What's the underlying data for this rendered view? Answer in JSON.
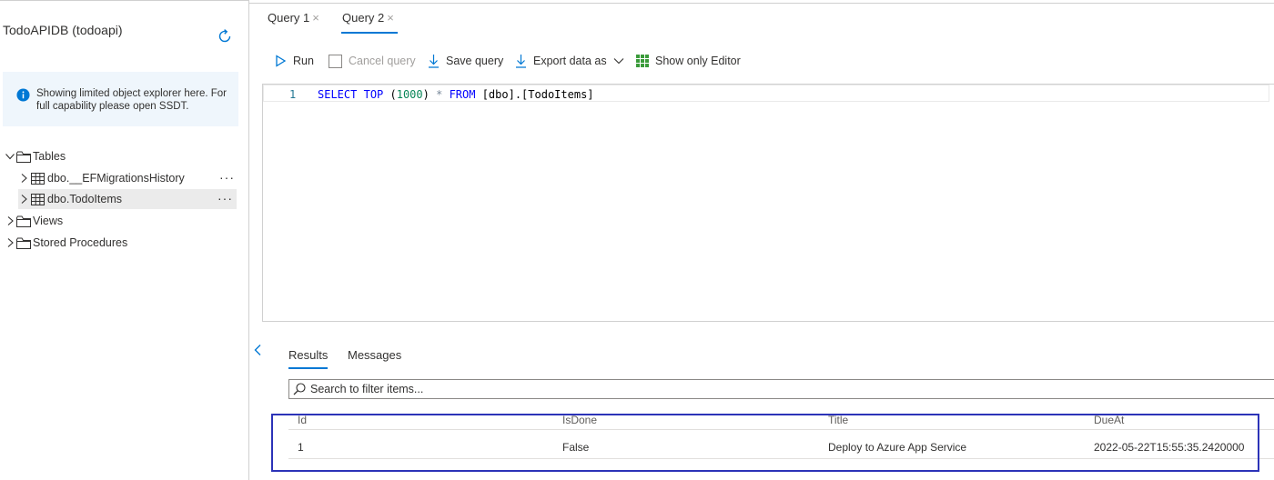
{
  "explorer": {
    "db_title": "TodoAPIDB (todoapi)",
    "info_text": "Showing limited object explorer here. For full capability please open SSDT.",
    "tree": {
      "tables_label": "Tables",
      "tables": [
        {
          "label": "dbo.__EFMigrationsHistory",
          "more": "···"
        },
        {
          "label": "dbo.TodoItems",
          "more": "···"
        }
      ],
      "views_label": "Views",
      "procedures_label": "Stored Procedures"
    }
  },
  "tabs": [
    {
      "label": "Query 1",
      "close": "×"
    },
    {
      "label": "Query 2",
      "close": "×"
    }
  ],
  "toolbar": {
    "run": "Run",
    "cancel": "Cancel query",
    "save": "Save query",
    "export": "Export data as",
    "show_editor": "Show only Editor"
  },
  "editor": {
    "line_number": "1",
    "tokens": {
      "select": "SELECT",
      "top": "TOP",
      "open_paren": " (",
      "limit": "1000",
      "close_paren": ") ",
      "star": "*",
      "from": "FROM",
      "target": " [dbo].[TodoItems]"
    }
  },
  "results": {
    "tabs": [
      "Results",
      "Messages"
    ],
    "filter_placeholder": "Search to filter items...",
    "columns": [
      "Id",
      "IsDone",
      "Title",
      "DueAt"
    ],
    "rows": [
      [
        "1",
        "False",
        "Deploy to Azure App Service",
        "2022-05-22T15:55:35.2420000"
      ]
    ]
  },
  "colors": {
    "accent": "#0078d4",
    "highlight_box": "#2c33b8",
    "info_background": "#eff6fc",
    "sql_keyword": "#0000ff",
    "sql_number": "#098658"
  },
  "icons": {
    "refresh": "refresh-icon",
    "info": "info-icon",
    "folder": "folder-icon",
    "table": "table-icon",
    "run": "play-icon",
    "cancel": "checkbox-icon",
    "save": "download-icon",
    "export": "download-icon",
    "show_editor": "grid-icon",
    "search": "search-icon"
  }
}
